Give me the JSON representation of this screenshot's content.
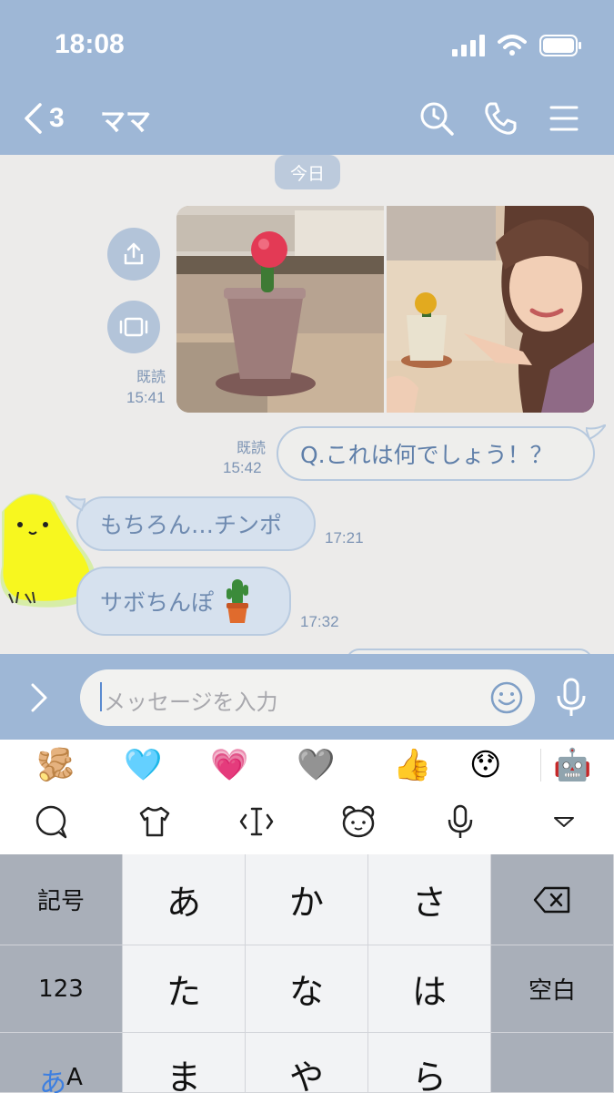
{
  "status": {
    "time": "18:08"
  },
  "header": {
    "back_count": "3",
    "title": "ママ"
  },
  "chat": {
    "date_label": "今日",
    "photo_read": "既読",
    "photo_time": "15:41",
    "outgoing": {
      "read": "既読",
      "time": "15:42",
      "text": "Q.これは何でしょう！？"
    },
    "incoming": [
      {
        "text": "もちろん…チンポ",
        "time": "17:21"
      },
      {
        "text": "サボちんぽ",
        "time": "17:32"
      }
    ]
  },
  "input": {
    "placeholder": "メッセージを入力"
  },
  "emoji_bar": [
    "🫚",
    "🩵",
    "💗",
    "🩶",
    "👍",
    "😯",
    "🤖"
  ],
  "keyboard": {
    "keys": [
      "あ",
      "か",
      "さ",
      "た",
      "な",
      "は",
      "ま",
      "や",
      "ら"
    ],
    "symbol": "記号",
    "numbers": "123",
    "space": "空白",
    "mode_kana": "あ",
    "mode_alpha": "A"
  },
  "colors": {
    "header": "#9eb7d6",
    "bubble_in": "#d6e1ee",
    "accent_text": "#6e8ab0"
  }
}
